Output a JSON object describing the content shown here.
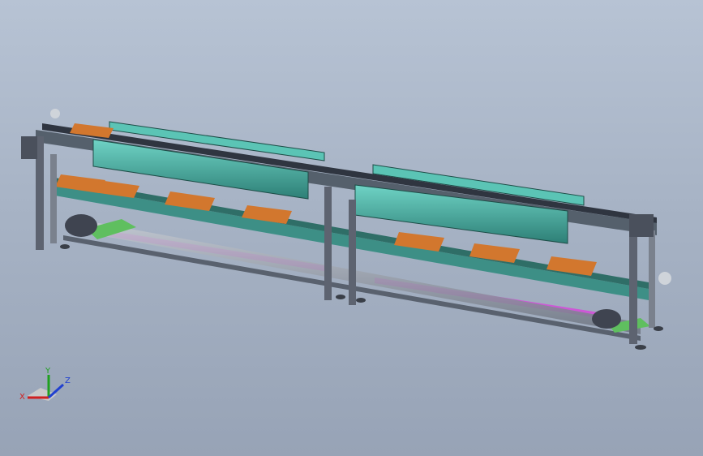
{
  "triad": {
    "x_label": "X",
    "y_label": "Y",
    "z_label": "Z",
    "x_color": "#d02020",
    "y_color": "#20a020",
    "z_color": "#2040d0"
  },
  "colors": {
    "background_top": "#b7c3d4",
    "background_bottom": "#97a3b6",
    "frame": "#5d6370",
    "frame_light": "#a9b1bd",
    "module_cyan": "#3fa79a",
    "pallet_orange": "#d2772e",
    "accent_magenta": "#d24fd8",
    "base_green": "#5fbf5f"
  },
  "icons": {
    "orientation": "triad-icon",
    "module": "conveyor-assembly-icon"
  }
}
